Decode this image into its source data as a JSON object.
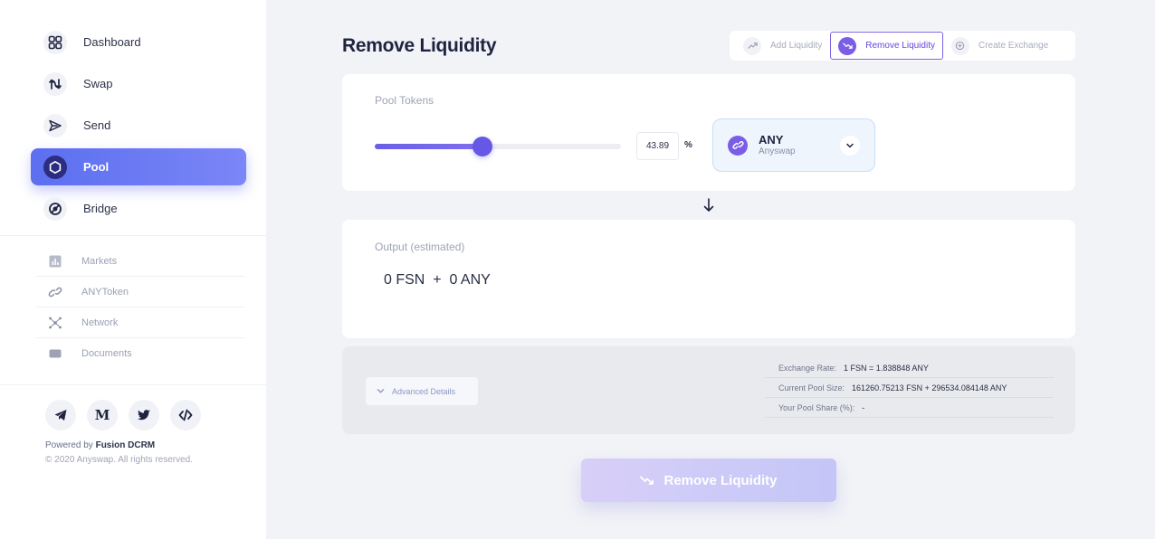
{
  "sidebar": {
    "nav": [
      {
        "label": "Dashboard",
        "icon": "dashboard-icon"
      },
      {
        "label": "Swap",
        "icon": "swap-icon"
      },
      {
        "label": "Send",
        "icon": "send-icon"
      },
      {
        "label": "Pool",
        "icon": "pool-icon",
        "active": true
      },
      {
        "label": "Bridge",
        "icon": "bridge-icon"
      }
    ],
    "secondary": [
      {
        "label": "Markets",
        "icon": "markets-icon"
      },
      {
        "label": "ANYToken",
        "icon": "link-icon"
      },
      {
        "label": "Network",
        "icon": "network-icon"
      },
      {
        "label": "Documents",
        "icon": "documents-icon"
      }
    ],
    "socials": [
      {
        "icon": "telegram-icon"
      },
      {
        "icon": "medium-icon",
        "glyph": "M"
      },
      {
        "icon": "twitter-icon"
      },
      {
        "icon": "code-icon"
      }
    ],
    "powered_prefix": "Powered by ",
    "powered_brand": "Fusion DCRM",
    "copyright": "© 2020 Anyswap. All rights reserved."
  },
  "header": {
    "title": "Remove Liquidity",
    "tabs": [
      {
        "label": "Add Liquidity",
        "active": false
      },
      {
        "label": "Remove Liquidity",
        "active": true
      },
      {
        "label": "Create Exchange",
        "active": false
      }
    ]
  },
  "pool": {
    "label": "Pool Tokens",
    "percent": "43.89",
    "percent_value": 43.89,
    "percent_sign": "%",
    "token": {
      "symbol": "ANY",
      "name": "Anyswap"
    }
  },
  "output": {
    "label": "Output (estimated)",
    "value": "0 FSN  +  0 ANY"
  },
  "details": {
    "toggle_label": "Advanced Details",
    "rows": [
      {
        "key": "Exchange Rate:",
        "value": "1 FSN = 1.838848 ANY"
      },
      {
        "key": "Current Pool Size:",
        "value": "161260.75213 FSN + 296534.084148 ANY"
      },
      {
        "key": "Your Pool Share (%):",
        "value": "-"
      }
    ]
  },
  "action": {
    "label": "Remove Liquidity"
  },
  "colors": {
    "accent": "#6657e6",
    "active_nav": "#5c6ff0",
    "page_bg": "#f2f3f7"
  }
}
